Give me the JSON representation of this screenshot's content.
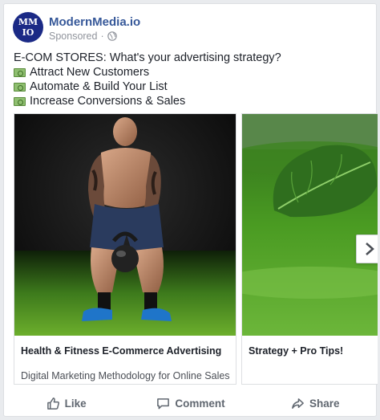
{
  "post": {
    "page_avatar": {
      "line1": "MM",
      "line2": "IO"
    },
    "page_name": "ModernMedia.io",
    "sponsored": "Sponsored",
    "meta_separator": "·",
    "privacy_icon": "globe-icon",
    "body": {
      "headline": "E-COM STORES: What's your advertising strategy?",
      "bullets": [
        {
          "icon": "money-emoji-icon",
          "text": "Attract New Customers"
        },
        {
          "icon": "money-emoji-icon",
          "text": "Automate & Build Your List"
        },
        {
          "icon": "money-emoji-icon",
          "text": "Increase Conversions & Sales"
        }
      ]
    },
    "carousel": {
      "cards": [
        {
          "image": "man-lifting-kettlebell",
          "title": "Health & Fitness E-Commerce Advertising",
          "description": "Digital Marketing Methodology for Online Sales"
        },
        {
          "image": "green-smoothie-with-spinach",
          "title": "Strategy + Pro Tips!",
          "description": ""
        }
      ],
      "next_icon": "chevron-right-icon"
    },
    "actions": {
      "like": "Like",
      "comment": "Comment",
      "share": "Share"
    },
    "colors": {
      "page_name": "#365899",
      "avatar_bg": "#1b2a86",
      "meta_text": "#90949c",
      "action_text": "#606770"
    }
  }
}
